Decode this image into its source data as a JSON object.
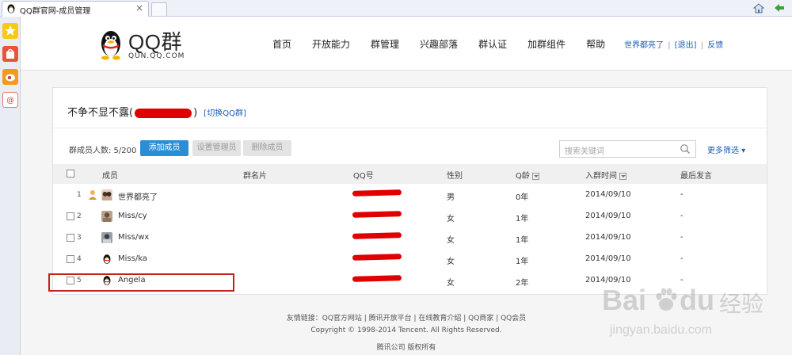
{
  "browser": {
    "tab_title": "QQ群官网-成员管理",
    "tab_close": "×"
  },
  "header": {
    "logo_text": "QQ群",
    "logo_sub": "QUN.QQ.COM",
    "nav": [
      "首页",
      "开放能力",
      "群管理",
      "兴趣部落",
      "群认证",
      "加群组件",
      "帮助"
    ],
    "user_name": "世界都亮了",
    "logout": "[退出]",
    "feedback": "反馈",
    "sep": "|"
  },
  "group": {
    "name": "不争不显不露(",
    "name_end": ")",
    "switch": "[切换QQ群]",
    "count_label": "群成员人数: 5/200"
  },
  "toolbar": {
    "add_label": "添加成员",
    "admin_label": "设置管理员",
    "delete_label": "删除成员",
    "search_placeholder": "搜索关键词",
    "more_filter": "更多筛选 ▾"
  },
  "table": {
    "headers": [
      "成员",
      "群名片",
      "QQ号",
      "性别",
      "Q龄",
      "入群时间",
      "最后发言"
    ],
    "rows": [
      {
        "num": "1",
        "name": "世界都亮了",
        "gender": "男",
        "qage": "0年",
        "join": "2014/09/10",
        "last": "-"
      },
      {
        "num": "2",
        "name": "Miss/cy",
        "gender": "女",
        "qage": "1年",
        "join": "2014/09/10",
        "last": "-"
      },
      {
        "num": "3",
        "name": "Miss/wx",
        "gender": "女",
        "qage": "1年",
        "join": "2014/09/10",
        "last": "-"
      },
      {
        "num": "4",
        "name": "Miss/ka",
        "gender": "女",
        "qage": "1年",
        "join": "2014/09/10",
        "last": "-"
      },
      {
        "num": "5",
        "name": "Angela",
        "gender": "女",
        "qage": "2年",
        "join": "2014/09/10",
        "last": "-"
      }
    ]
  },
  "footer": {
    "links_label": "友情链接：",
    "links": "QQ官方网站 | 腾讯开放平台 | 在线教育介绍 | QQ商家 | QQ会员",
    "copyright": "Copyright © 1998-2014 Tencent. All Rights Reserved.",
    "owner": "腾讯公司 版权所有"
  },
  "watermark": {
    "brand": "Bai",
    "brand2": "du",
    "cn": "经验",
    "url": "jingyan.baidu.com"
  },
  "colors": {
    "accent": "#2b8ed4",
    "link": "#1b5fb4",
    "redaction": "#e00000",
    "highlight": "#c7201c"
  }
}
